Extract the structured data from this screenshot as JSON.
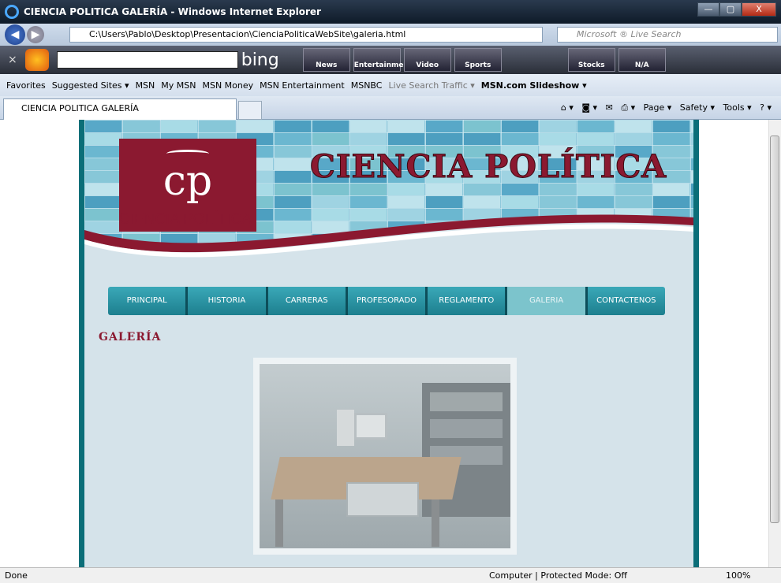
{
  "window": {
    "title": "CIENCIA POLITICA GALERÍA - Windows Internet Explorer",
    "min": "—",
    "max": "▢",
    "close": "X"
  },
  "address": {
    "url": "C:\\Users\\Pablo\\Desktop\\Presentacion\\CienciaPoliticaWebSite\\galeria.html",
    "search_placeholder": "Microsoft ® Live Search"
  },
  "bing": {
    "logo_text": "bing",
    "buttons": [
      "News",
      "Entertainment",
      "Video",
      "Sports"
    ],
    "stocks": "Stocks",
    "na": "N/A"
  },
  "favorites": {
    "label": "Favorites",
    "items": [
      "Suggested Sites ▾",
      "MSN",
      "My MSN",
      "MSN Money",
      "MSN Entertainment",
      "MSNBC",
      "Live Search Traffic ▾",
      "MSN.com Slideshow ▾"
    ]
  },
  "tab": {
    "title": "CIENCIA POLITICA GALERÍA"
  },
  "commands": {
    "page": "Page ▾",
    "safety": "Safety ▾",
    "tools": "Tools ▾"
  },
  "site": {
    "logo_initials": "cp",
    "logo_text": "CIENCIA POLÍTICA",
    "banner_title": "CIENCIA POLÍTICA",
    "menu": [
      "Principal",
      "Historia",
      "Carreras",
      "Profesorado",
      "Reglamento",
      "Galeria",
      "Contactenos"
    ],
    "active_menu": "Galeria",
    "section_title": "GALERÍA"
  },
  "status": {
    "left": "Done",
    "zone": "Computer | Protected Mode: Off",
    "zoom": "100%"
  },
  "colors": {
    "brand": "#8b1930",
    "teal": "#0b6e78",
    "menu": "#2a97a6",
    "page_bg": "#d5e3ea"
  }
}
